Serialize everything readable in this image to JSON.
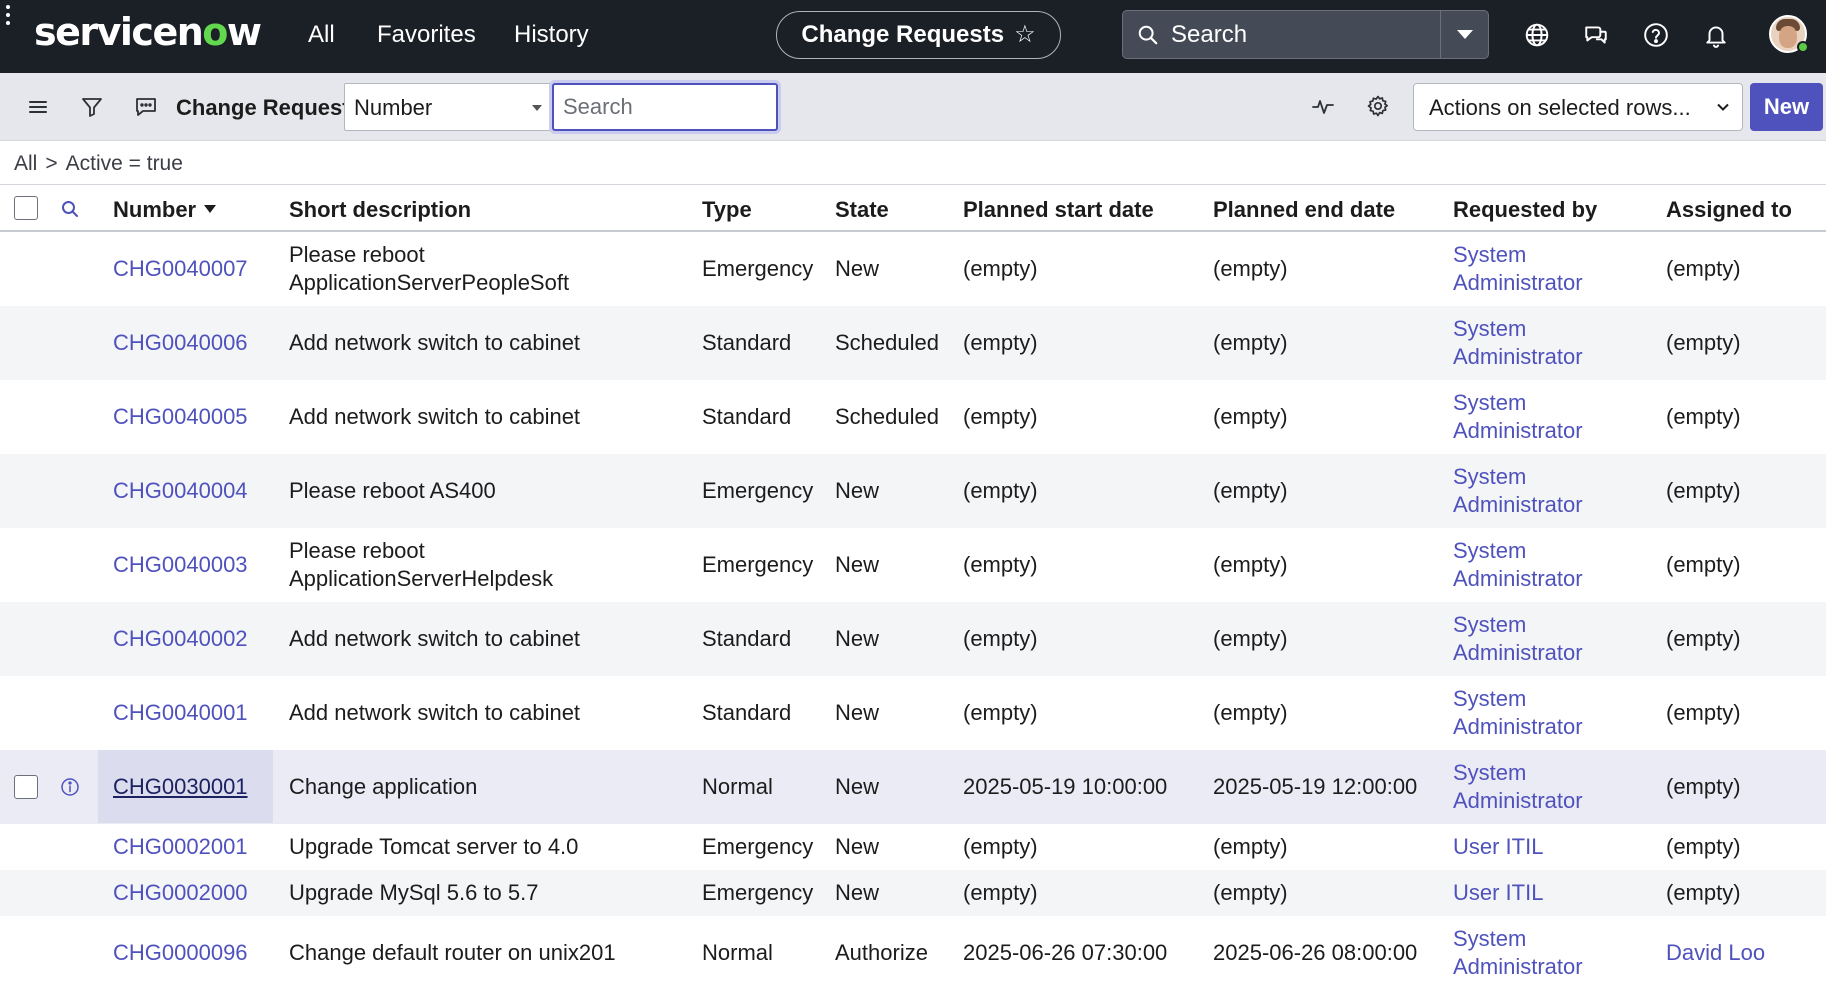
{
  "topbar": {
    "logo_main": "servicen",
    "logo_accent": "o",
    "logo_end": "w",
    "nav": {
      "all": "All",
      "favorites": "Favorites",
      "history": "History"
    },
    "context_title": "Change Requests",
    "search_label": "Search",
    "icons": [
      "globe-icon",
      "chat-icon",
      "help-icon",
      "bell-icon"
    ]
  },
  "toolbar": {
    "title": "Change Requests",
    "field_select_value": "Number",
    "search_placeholder": "Search",
    "actions_label": "Actions on selected rows...",
    "new_label": "New"
  },
  "breadcrumb": {
    "root": "All",
    "separator": ">",
    "condition": "Active = true"
  },
  "columns": {
    "number": "Number",
    "short_description": "Short description",
    "type": "Type",
    "state": "State",
    "planned_start": "Planned start date",
    "planned_end": "Planned end date",
    "requested_by": "Requested by",
    "assigned_to": "Assigned to"
  },
  "rows": [
    {
      "number": "CHG0040007",
      "desc1": "Please reboot",
      "desc2": "ApplicationServerPeopleSoft",
      "type": "Emergency",
      "state": "New",
      "start": "(empty)",
      "end": "(empty)",
      "req1": "System",
      "req2": "Administrator",
      "assigned": "(empty)"
    },
    {
      "number": "CHG0040006",
      "desc1": "Add network switch to cabinet",
      "desc2": "",
      "type": "Standard",
      "state": "Scheduled",
      "start": "(empty)",
      "end": "(empty)",
      "req1": "System",
      "req2": "Administrator",
      "assigned": "(empty)"
    },
    {
      "number": "CHG0040005",
      "desc1": "Add network switch to cabinet",
      "desc2": "",
      "type": "Standard",
      "state": "Scheduled",
      "start": "(empty)",
      "end": "(empty)",
      "req1": "System",
      "req2": "Administrator",
      "assigned": "(empty)"
    },
    {
      "number": "CHG0040004",
      "desc1": "Please reboot AS400",
      "desc2": "",
      "type": "Emergency",
      "state": "New",
      "start": "(empty)",
      "end": "(empty)",
      "req1": "System",
      "req2": "Administrator",
      "assigned": "(empty)"
    },
    {
      "number": "CHG0040003",
      "desc1": "Please reboot",
      "desc2": "ApplicationServerHelpdesk",
      "type": "Emergency",
      "state": "New",
      "start": "(empty)",
      "end": "(empty)",
      "req1": "System",
      "req2": "Administrator",
      "assigned": "(empty)"
    },
    {
      "number": "CHG0040002",
      "desc1": "Add network switch to cabinet",
      "desc2": "",
      "type": "Standard",
      "state": "New",
      "start": "(empty)",
      "end": "(empty)",
      "req1": "System",
      "req2": "Administrator",
      "assigned": "(empty)"
    },
    {
      "number": "CHG0040001",
      "desc1": "Add network switch to cabinet",
      "desc2": "",
      "type": "Standard",
      "state": "New",
      "start": "(empty)",
      "end": "(empty)",
      "req1": "System",
      "req2": "Administrator",
      "assigned": "(empty)"
    },
    {
      "number": "CHG0030001",
      "desc1": "Change application",
      "desc2": "",
      "type": "Normal",
      "state": "New",
      "start": "2025-05-19 10:00:00",
      "end": "2025-05-19 12:00:00",
      "req1": "System",
      "req2": "Administrator",
      "assigned": "(empty)"
    },
    {
      "number": "CHG0002001",
      "desc1": "Upgrade Tomcat server to 4.0",
      "desc2": "",
      "type": "Emergency",
      "state": "New",
      "start": "(empty)",
      "end": "(empty)",
      "req1": "User ITIL",
      "req2": "",
      "assigned": "(empty)"
    },
    {
      "number": "CHG0002000",
      "desc1": "Upgrade MySql 5.6 to 5.7",
      "desc2": "",
      "type": "Emergency",
      "state": "New",
      "start": "(empty)",
      "end": "(empty)",
      "req1": "User ITIL",
      "req2": "",
      "assigned": "(empty)"
    },
    {
      "number": "CHG0000096",
      "desc1": "Change default router on unix201",
      "desc2": "",
      "type": "Normal",
      "state": "Authorize",
      "start": "2025-06-26 07:30:00",
      "end": "2025-06-26 08:00:00",
      "req1": "System",
      "req2": "Administrator",
      "assigned": "David Loo"
    }
  ],
  "colors": {
    "accent": "#4f52bd",
    "topbar": "#1b1f26",
    "toolbar": "#e5e7ec",
    "status_online": "#5acb45"
  }
}
